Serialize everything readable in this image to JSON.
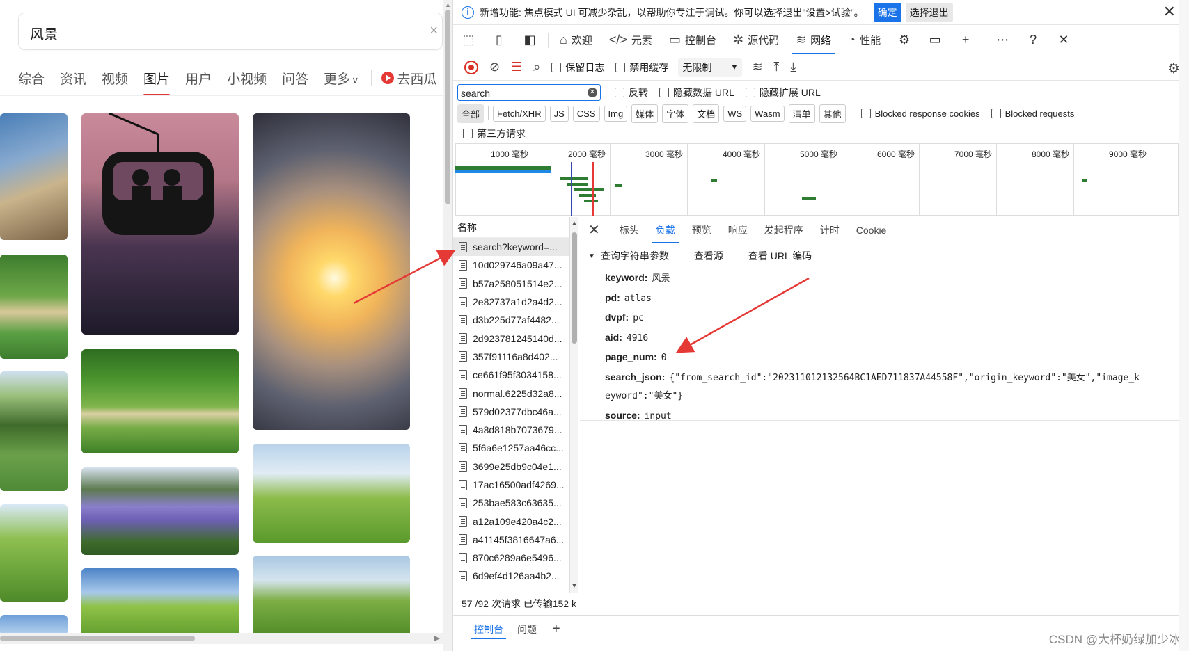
{
  "left": {
    "search_value": "风景",
    "tabs": [
      "综合",
      "资讯",
      "视频",
      "图片",
      "用户",
      "小视频",
      "问答",
      "更多"
    ],
    "active_tab": "图片",
    "more_arrow": "∨",
    "xigua_label": "去西瓜"
  },
  "devtools": {
    "infobar": {
      "text": "新增功能: 焦点模式 UI 可减少杂乱，以帮助你专注于调试。你可以选择退出\"设置>试验\"。",
      "ok": "确定",
      "exit": "选择退出"
    },
    "tabs": [
      {
        "label": "欢迎",
        "icon": "⌂"
      },
      {
        "label": "元素",
        "icon": "</>"
      },
      {
        "label": "控制台",
        "icon": "▭"
      },
      {
        "label": "源代码",
        "icon": "✲"
      },
      {
        "label": "网络",
        "icon": "≋"
      },
      {
        "label": "性能",
        "icon": "◔"
      }
    ],
    "active_tab": "网络",
    "toolbar": {
      "preserve_log": "保留日志",
      "disable_cache": "禁用缓存",
      "throttle": "无限制"
    },
    "filter": {
      "value": "search",
      "invert": "反转",
      "hide_data_urls": "隐藏数据 URL",
      "hide_ext_urls": "隐藏扩展 URL"
    },
    "types": [
      "全部",
      "Fetch/XHR",
      "JS",
      "CSS",
      "Img",
      "媒体",
      "字体",
      "文档",
      "WS",
      "Wasm",
      "清单",
      "其他"
    ],
    "blocked_cookies": "Blocked response cookies",
    "blocked_requests": "Blocked requests",
    "third_party": "第三方请求",
    "timeline_ticks": [
      "1000 毫秒",
      "2000 毫秒",
      "3000 毫秒",
      "4000 毫秒",
      "5000 毫秒",
      "6000 毫秒",
      "7000 毫秒",
      "8000 毫秒",
      "9000 毫秒"
    ],
    "name_header": "名称",
    "requests": [
      "search?keyword=...",
      "10d029746a09a47...",
      "b57a258051514e2...",
      "2e82737a1d2a4d2...",
      "d3b225d77af4482...",
      "2d923781245140d...",
      "357f91116a8d402...",
      "ce661f95f3034158...",
      "normal.6225d32a8...",
      "579d02377dbc46a...",
      "4a8d818b7073679...",
      "5f6a6e1257aa46cc...",
      "3699e25db9c04e1...",
      "17ac16500adf4269...",
      "253bae583c63635...",
      "a12a109e420a4c2...",
      "a41145f3816647a6...",
      "870c6289a6e5496...",
      "6d9ef4d126aa4b2..."
    ],
    "status": "57 /92 次请求  已传输152 k",
    "detail_tabs": [
      "标头",
      "负载",
      "预览",
      "响应",
      "发起程序",
      "计时",
      "Cookie"
    ],
    "active_detail_tab": "负载",
    "section": {
      "title": "查询字符串参数",
      "view_source": "查看源",
      "view_url_encoded": "查看 URL 编码"
    },
    "params": [
      {
        "k": "keyword:",
        "v": "风景"
      },
      {
        "k": "pd:",
        "v": "atlas"
      },
      {
        "k": "dvpf:",
        "v": "pc"
      },
      {
        "k": "aid:",
        "v": "4916"
      },
      {
        "k": "page_num:",
        "v": "0"
      },
      {
        "k": "search_json:",
        "v": "{\"from_search_id\":\"202311012132564BC1AED711837A44558F\",\"origin_keyword\":\"美女\",\"image_k"
      },
      {
        "k": "",
        "v": "eyword\":\"美女\"}"
      },
      {
        "k": "source:",
        "v": "input"
      }
    ],
    "bottom_tabs": [
      "控制台",
      "问题"
    ],
    "active_bottom_tab": "控制台",
    "watermark": "CSDN @大杯奶绿加少冰"
  }
}
